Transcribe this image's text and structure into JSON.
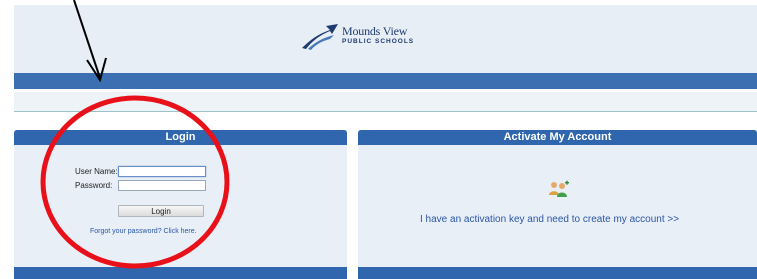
{
  "header": {
    "logo_name": "Mounds View",
    "logo_sub": "PUBLIC SCHOOLS"
  },
  "login_panel": {
    "title": "Login",
    "username_label": "User Name:",
    "username_value": "",
    "password_label": "Password:",
    "password_value": "",
    "login_button": "Login",
    "forgot_link": "Forgot your password? Click here."
  },
  "activate_panel": {
    "title": "Activate My Account",
    "link_text": "I have an activation key and need to create my account >>",
    "icon": "users-add-icon"
  },
  "annotation": {
    "arrow_color": "#000000",
    "circle_color": "#e8111a"
  },
  "colors": {
    "header_bg": "#e7eef6",
    "nav_bar": "#3b6fb2",
    "panel_head": "#2f66ad",
    "panel_bg": "#e9eff7",
    "link": "#2a56a8"
  }
}
